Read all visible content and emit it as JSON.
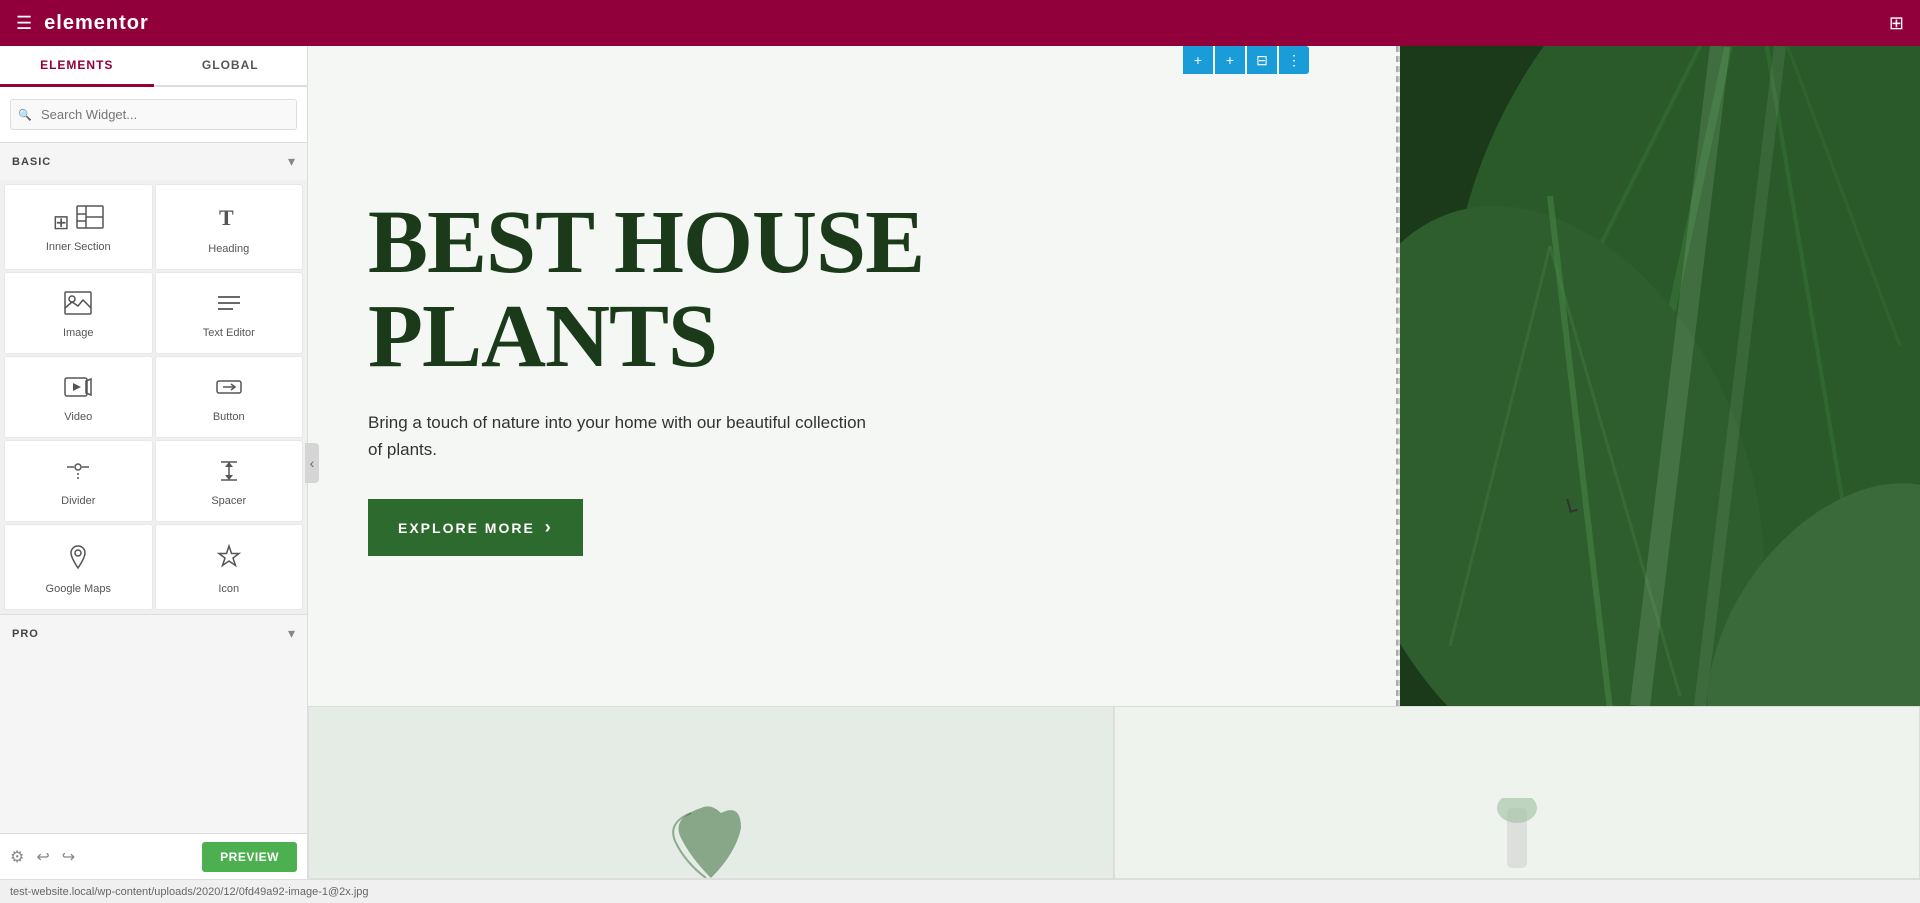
{
  "topbar": {
    "logo_text": "elementor",
    "hamburger_label": "☰",
    "grid_label": "⊞"
  },
  "sidebar": {
    "tabs": [
      {
        "id": "elements",
        "label": "ELEMENTS",
        "active": true
      },
      {
        "id": "global",
        "label": "GLOBAL",
        "active": false
      }
    ],
    "search_placeholder": "Search Widget...",
    "basic_section_label": "BASIC",
    "pro_section_label": "PRO",
    "widgets": [
      {
        "id": "inner-section",
        "label": "Inner Section",
        "icon": "inner-section"
      },
      {
        "id": "heading",
        "label": "Heading",
        "icon": "heading"
      },
      {
        "id": "image",
        "label": "Image",
        "icon": "image"
      },
      {
        "id": "text-editor",
        "label": "Text Editor",
        "icon": "text-editor"
      },
      {
        "id": "video",
        "label": "Video",
        "icon": "video"
      },
      {
        "id": "button",
        "label": "Button",
        "icon": "button"
      },
      {
        "id": "divider",
        "label": "Divider",
        "icon": "divider"
      },
      {
        "id": "spacer",
        "label": "Spacer",
        "icon": "spacer"
      },
      {
        "id": "google-maps",
        "label": "Google Maps",
        "icon": "googlemaps"
      },
      {
        "id": "icon",
        "label": "Icon",
        "icon": "icon"
      }
    ],
    "bottom_icons": [
      "⚙",
      "↩",
      "↪"
    ],
    "preview_label": "PREVIEW"
  },
  "canvas": {
    "toolbar_buttons": [
      "+",
      "+",
      "⊟",
      "⋮"
    ],
    "hero": {
      "title_line1": "BEST HOUSE",
      "title_line2": "PLANTS",
      "subtitle": "Bring a touch of nature into your home with our beautiful collection of plants.",
      "cta_label": "EXPLORE MORE",
      "cta_arrow": "›"
    }
  },
  "statusbar": {
    "url": "test-website.local/wp-content/uploads/2020/12/0fd49a92-image-1@2x.jpg"
  }
}
